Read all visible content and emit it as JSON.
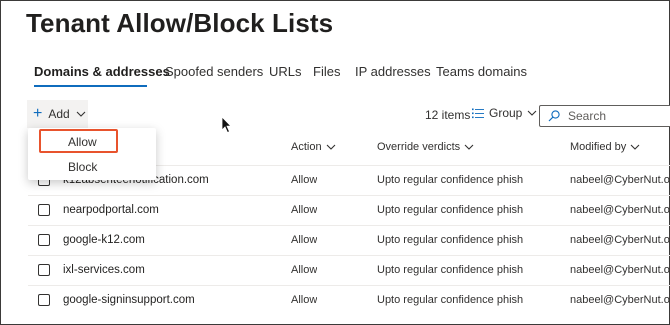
{
  "page": {
    "title": "Tenant Allow/Block Lists"
  },
  "tabs": [
    {
      "label": "Domains & addresses",
      "active": true
    },
    {
      "label": "Spoofed senders"
    },
    {
      "label": "URLs"
    },
    {
      "label": "Files"
    },
    {
      "label": "IP addresses"
    },
    {
      "label": "Teams domains"
    }
  ],
  "toolbar": {
    "add_label": "Add",
    "items_count": "12 items",
    "group_label": "Group",
    "search_placeholder": "Search"
  },
  "dropdown": {
    "items": [
      {
        "label": "Allow",
        "highlighted": true
      },
      {
        "label": "Block"
      }
    ]
  },
  "table": {
    "columns": {
      "action": "Action",
      "override": "Override verdicts",
      "modified": "Modified by"
    },
    "rows": [
      {
        "name": "k12absenteenotification.com",
        "action": "Allow",
        "override": "Upto regular confidence phish",
        "modified": "nabeel@CyberNut.onmicrosoft.com"
      },
      {
        "name": "nearpodportal.com",
        "action": "Allow",
        "override": "Upto regular confidence phish",
        "modified": "nabeel@CyberNut.onmicrosoft.com"
      },
      {
        "name": "google-k12.com",
        "action": "Allow",
        "override": "Upto regular confidence phish",
        "modified": "nabeel@CyberNut.onmicrosoft.com"
      },
      {
        "name": "ixl-services.com",
        "action": "Allow",
        "override": "Upto regular confidence phish",
        "modified": "nabeel@CyberNut.onmicrosoft.com"
      },
      {
        "name": "google-signinsupport.com",
        "action": "Allow",
        "override": "Upto regular confidence phish",
        "modified": "nabeel@CyberNut.onmicrosoft.com"
      }
    ]
  },
  "colors": {
    "accent": "#0f6cbd",
    "highlight_border": "#e8532d"
  }
}
